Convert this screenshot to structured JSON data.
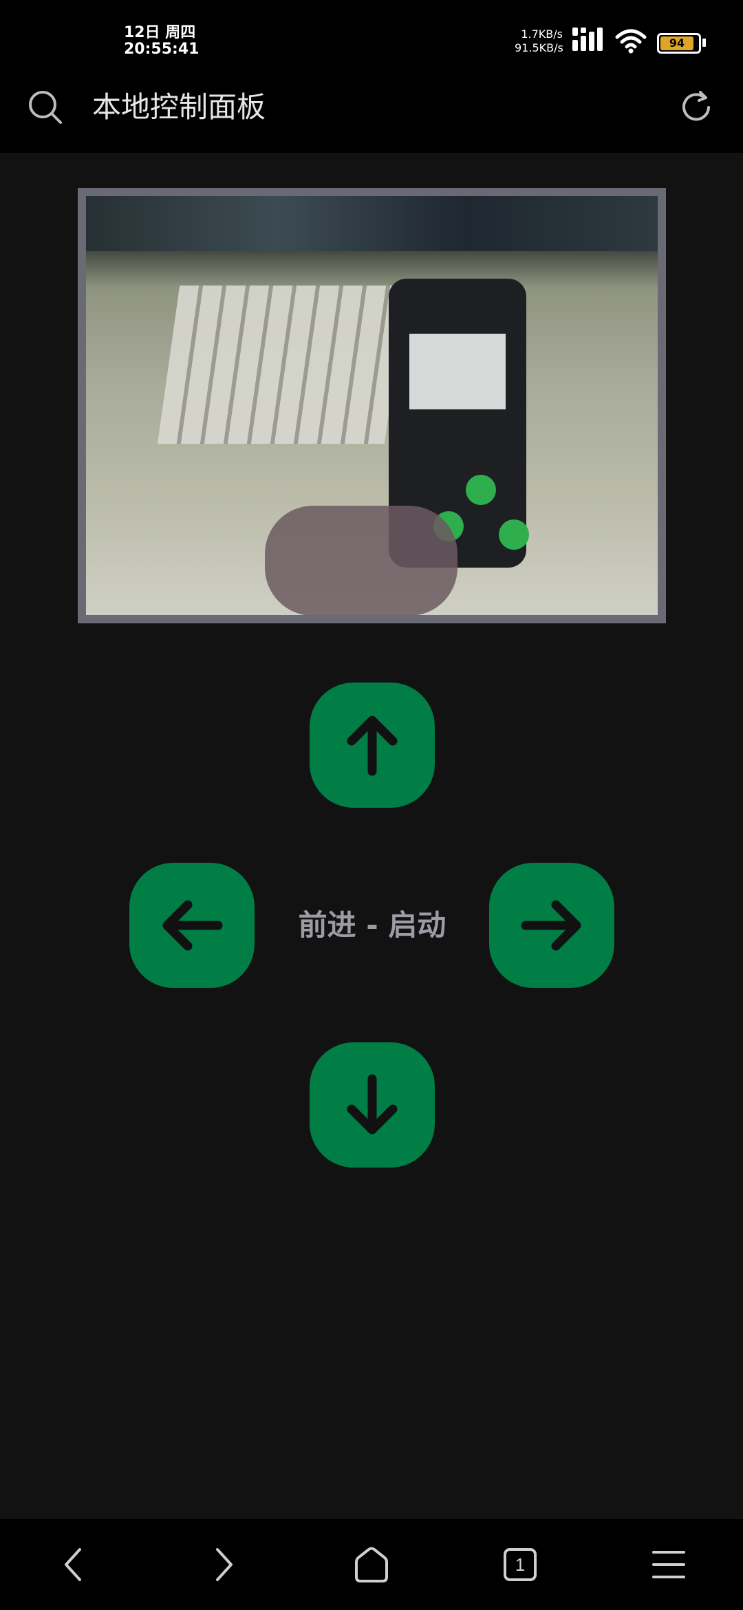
{
  "status_bar": {
    "date": "12日 周四",
    "time": "20:55:41",
    "net_up": "1.7KB/s",
    "net_down": "91.5KB/s",
    "battery": "94"
  },
  "header": {
    "title": "本地控制面板",
    "search_icon": "search-icon",
    "refresh_icon": "refresh-icon"
  },
  "controls": {
    "status_text": "前进 - 启动",
    "up_icon": "arrow-up-icon",
    "down_icon": "arrow-down-icon",
    "left_icon": "arrow-left-icon",
    "right_icon": "arrow-right-icon",
    "button_color": "#017e45"
  },
  "bottom_nav": {
    "tab_count": "1",
    "icons": [
      "back-icon",
      "forward-icon",
      "home-icon",
      "tabs-icon",
      "menu-icon"
    ]
  }
}
